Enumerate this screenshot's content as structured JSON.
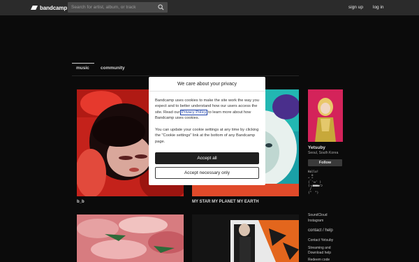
{
  "header": {
    "logo_text": "bandcamp",
    "search_placeholder": "Search for artist, album, or track",
    "signup_label": "sign up",
    "login_label": "log in"
  },
  "tabs": [
    {
      "label": "music",
      "active": true
    },
    {
      "label": "community",
      "active": false
    }
  ],
  "albums": [
    {
      "title": "b_b",
      "art": "red-photo-woman-portrait"
    },
    {
      "title": "MY STAR MY PLANET MY EARTH",
      "art": "teal-red-face-artwork"
    },
    {
      "title": "",
      "art": "pink-meat-slices-photo"
    },
    {
      "title": "",
      "art": "orange-pattern-figure-artwork"
    }
  ],
  "sidebar": {
    "artist_name": "Yetsuby",
    "location": "Seoul, South Korea",
    "follow_label": "Follow",
    "ascii_art": "Hallo!\n  o\n^_^\n( 'ㅂ' )\n(っ■■■●つ\n /\n(\"  \")",
    "links": [
      "SoundCloud",
      "Instagram"
    ],
    "contact_heading": "contact / help",
    "contact_links": [
      "Contact Yetsuby",
      "Streaming and",
      "Download help",
      "Redeem code"
    ]
  },
  "cookie_modal": {
    "title": "We care about your privacy",
    "p1_before": "Bandcamp uses cookies to make the site work the way you expect and to better understand how our users access the site. Read our ",
    "privacy_link": "Privacy Policy",
    "p1_after": " to learn more about how Bandcamp uses cookies.",
    "p2": "You can update your cookie settings at any time by clicking the \"Cookie settings\" link at the bottom of any Bandcamp page.",
    "accept_all_label": "Accept all",
    "accept_necessary_label": "Accept necessary only"
  }
}
